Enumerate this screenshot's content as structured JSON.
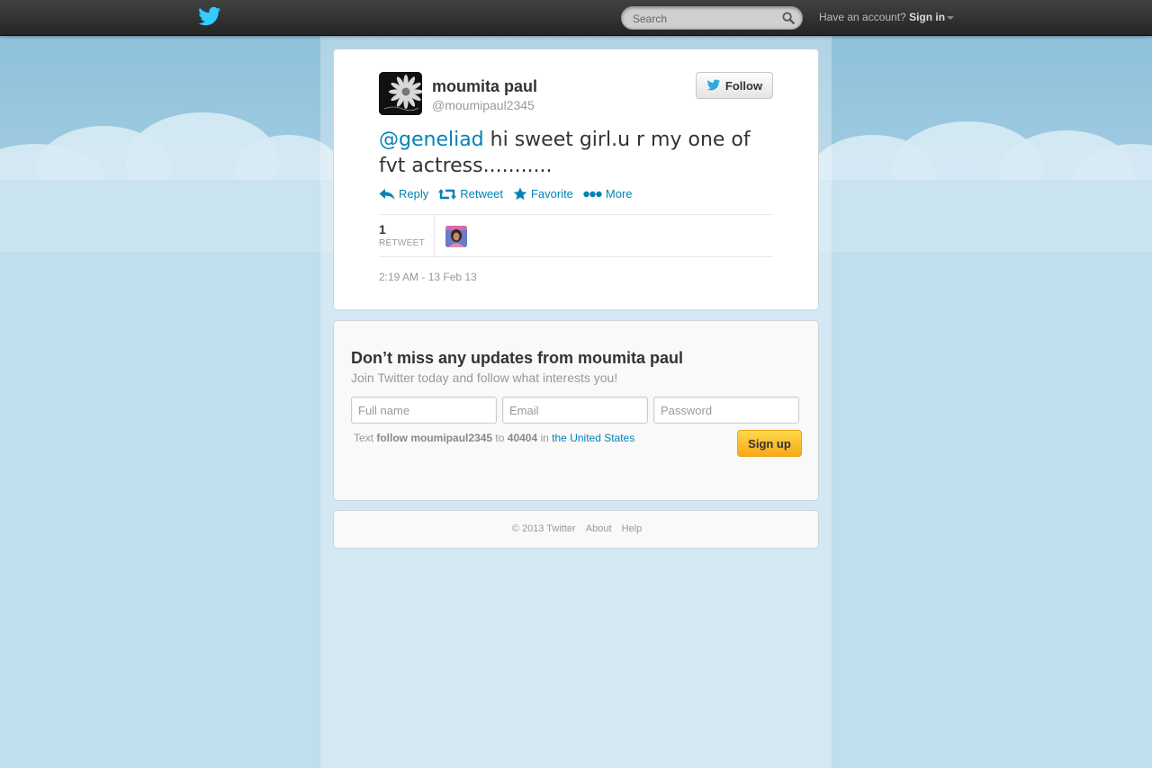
{
  "header": {
    "search_placeholder": "Search",
    "signin_prompt": "Have an account?",
    "signin_label": "Sign in"
  },
  "tweet": {
    "fullname": "moumita paul",
    "username": "@moumipaul2345",
    "follow_label": "Follow",
    "mention": "@geneliad",
    "text": " hi sweet girl.u r my one of fvt actress...........",
    "actions": {
      "reply": "Reply",
      "retweet": "Retweet",
      "favorite": "Favorite",
      "more": "More"
    },
    "retweet_count": "1",
    "retweet_label": "RETWEET",
    "timestamp": "2:19 AM - 13 Feb 13"
  },
  "signup": {
    "title": "Don’t miss any updates from moumita paul",
    "subtitle": "Join Twitter today and follow what interests you!",
    "fullname_placeholder": "Full name",
    "email_placeholder": "Email",
    "password_placeholder": "Password",
    "sms_text_prefix": "Text",
    "sms_command": "follow moumipaul2345",
    "sms_to": "to",
    "sms_number": "40404",
    "sms_in": "in",
    "sms_country": "the United States",
    "button_label": "Sign up"
  },
  "footer": {
    "copyright": "© 2013 Twitter",
    "about": "About",
    "help": "Help"
  },
  "colors": {
    "link": "#0084b4",
    "background": "#c0deed",
    "topbar": "#252525"
  }
}
